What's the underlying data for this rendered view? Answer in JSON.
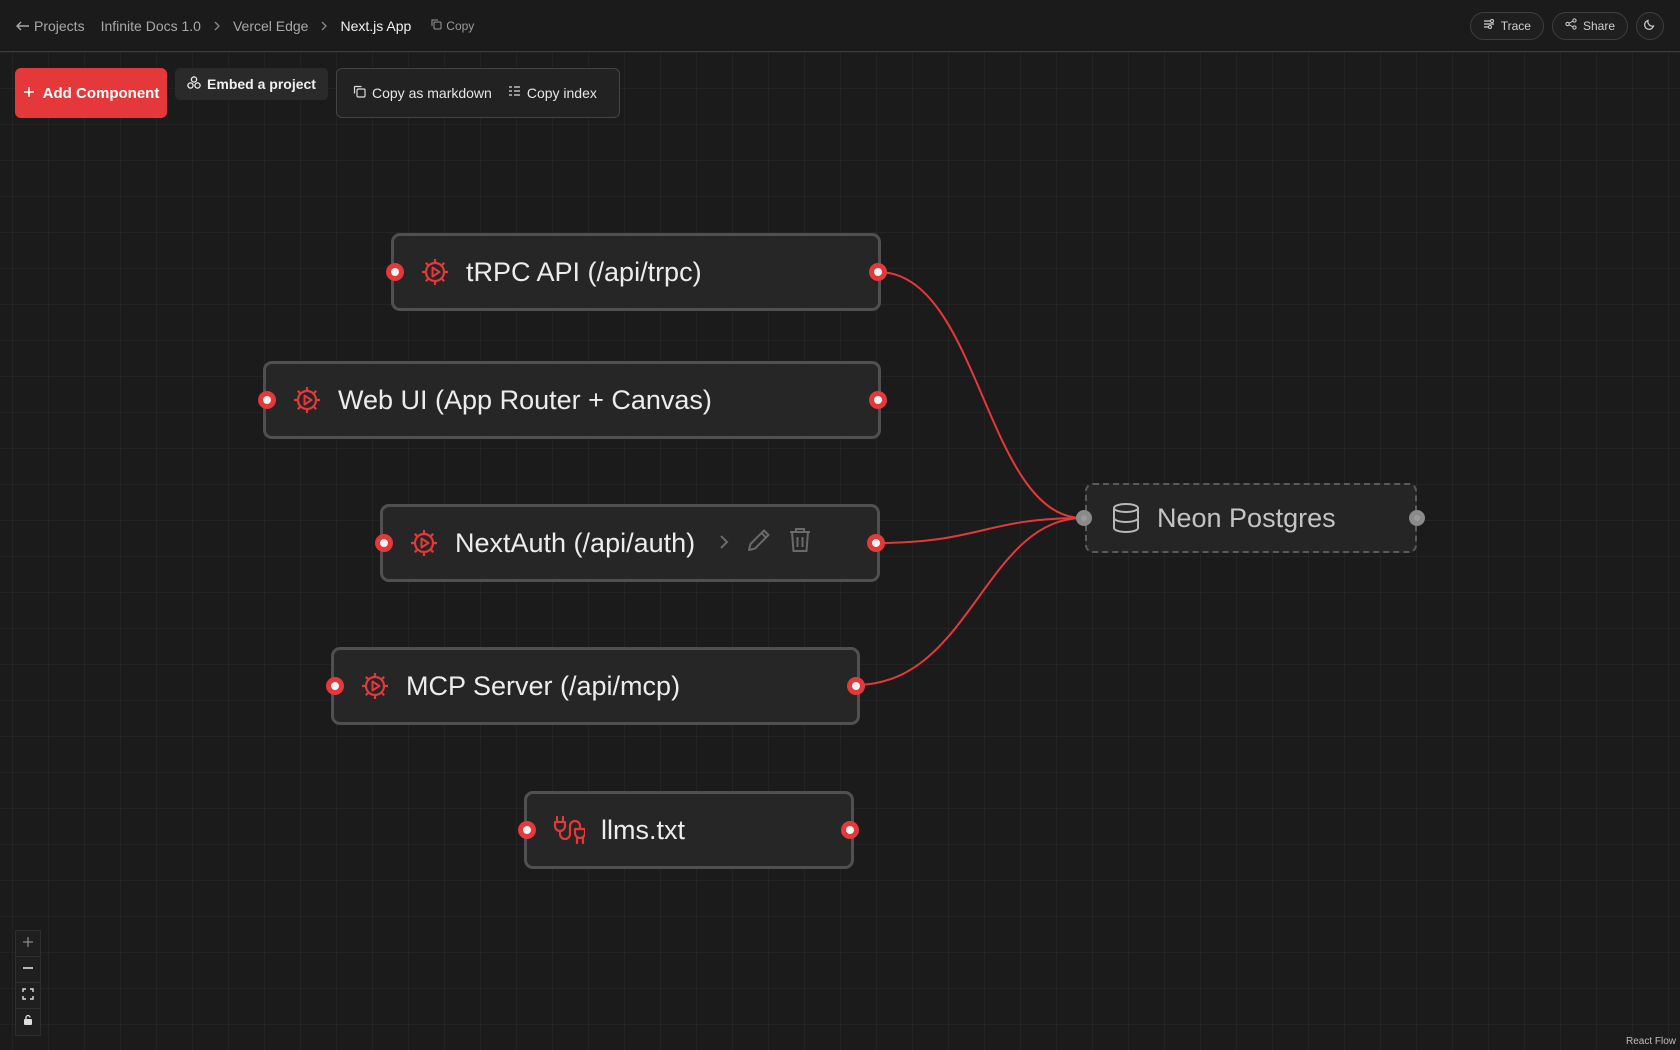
{
  "topbar": {
    "back_label": "Projects",
    "crumbs": [
      "Infinite Docs 1.0",
      "Vercel Edge",
      "Next.js App"
    ],
    "copy_label": "Copy",
    "trace_label": "Trace",
    "share_label": "Share"
  },
  "toolbar": {
    "add_label": "Add Component",
    "embed_label": "Embed a project",
    "copy_markdown_label": "Copy as markdown",
    "copy_index_label": "Copy index"
  },
  "nodes": {
    "trpc": "tRPC API (/api/trpc)",
    "webui": "Web UI (App Router + Canvas)",
    "nextauth": "NextAuth (/api/auth)",
    "mcp": "MCP Server (/api/mcp)",
    "llms": "llms.txt",
    "neon": "Neon Postgres"
  },
  "colors": {
    "accent": "#e5383b",
    "background": "#1b1b1b"
  },
  "attribution": "React Flow"
}
